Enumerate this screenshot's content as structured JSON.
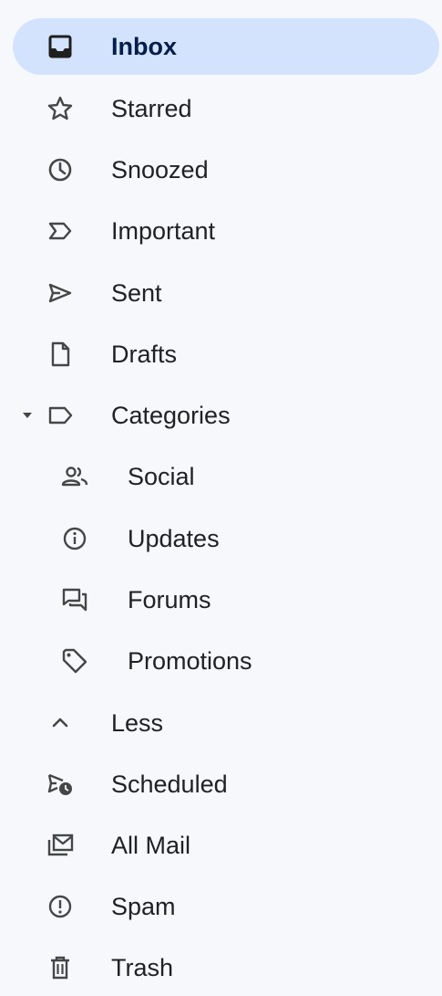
{
  "nav": {
    "items": [
      {
        "label": "Inbox",
        "icon": "inbox-icon",
        "active": true
      },
      {
        "label": "Starred",
        "icon": "star-icon"
      },
      {
        "label": "Snoozed",
        "icon": "clock-icon"
      },
      {
        "label": "Important",
        "icon": "important-icon"
      },
      {
        "label": "Sent",
        "icon": "send-icon"
      },
      {
        "label": "Drafts",
        "icon": "draft-icon"
      },
      {
        "label": "Categories",
        "icon": "label-icon",
        "expanded": true
      },
      {
        "label": "Social",
        "icon": "people-icon"
      },
      {
        "label": "Updates",
        "icon": "info-icon"
      },
      {
        "label": "Forums",
        "icon": "forum-icon"
      },
      {
        "label": "Promotions",
        "icon": "tag-icon"
      },
      {
        "label": "Less",
        "icon": "chevron-up-icon"
      },
      {
        "label": "Scheduled",
        "icon": "scheduled-send-icon"
      },
      {
        "label": "All Mail",
        "icon": "all-mail-icon"
      },
      {
        "label": "Spam",
        "icon": "spam-icon"
      },
      {
        "label": "Trash",
        "icon": "trash-icon"
      }
    ]
  },
  "colors": {
    "background": "#f6f8fc",
    "active_background": "#d3e3fd",
    "icon": "#444746"
  }
}
